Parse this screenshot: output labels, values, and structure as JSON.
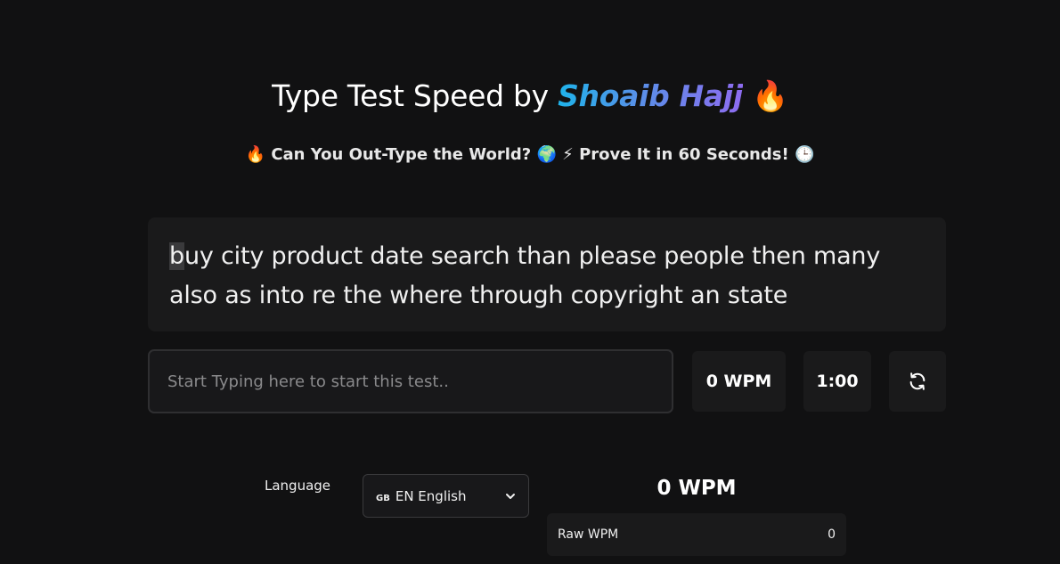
{
  "header": {
    "title_prefix": "Type Test Speed by ",
    "author": "Shoaib Hajj",
    "title_emoji": "🔥",
    "subtitle": "🔥 Can You Out-Type the World? 🌍 ⚡ Prove It in 60 Seconds! 🕒"
  },
  "test_text": {
    "current_char": "b",
    "remaining_text": "uy city product date search than please people then many also as into re the where through copyright an state"
  },
  "typing": {
    "placeholder": "Start Typing here to start this test..",
    "value": ""
  },
  "stats": {
    "wpm": "0 WPM",
    "timer": "1:00",
    "reset_icon": "refresh-icon"
  },
  "settings": {
    "language_label": "Language",
    "language_flag": "GB",
    "language_value": "EN English"
  },
  "results": {
    "wpm": "0 WPM",
    "raw_wpm_label": "Raw WPM",
    "raw_wpm_value": "0"
  }
}
